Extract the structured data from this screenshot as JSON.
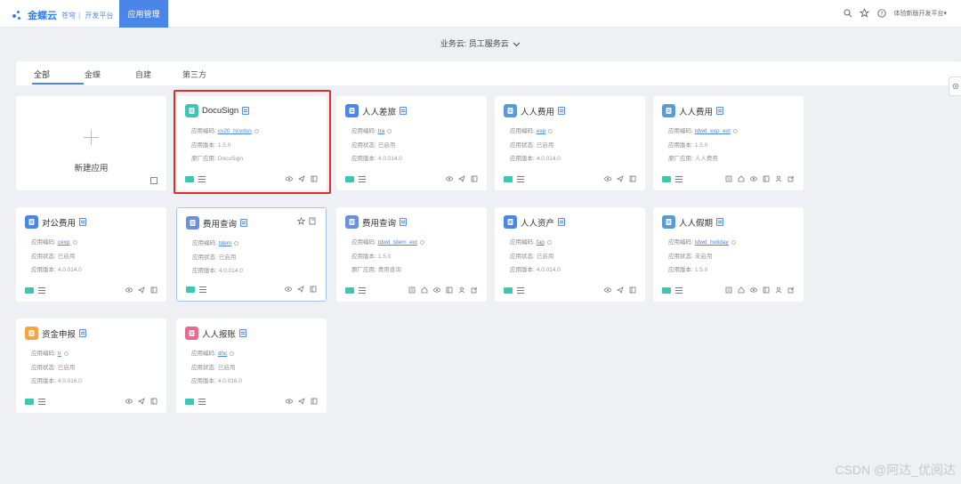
{
  "header": {
    "logo_text": "金蝶云",
    "logo_sub": "苍穹",
    "logo_sep": "|",
    "logo_platform": "开发平台",
    "active_tab": "应用管理",
    "user_menu": "体验新版开发平台"
  },
  "biz_cloud": {
    "label": "业务云:",
    "value": "员工服务云"
  },
  "tabs": [
    "全部",
    "金蝶",
    "自建",
    "第三方"
  ],
  "new_app_label": "新建应用",
  "field_labels": {
    "code": "应用编码:",
    "status": "应用状态:",
    "version": "应用版本:",
    "vendor": "原厂应用:"
  },
  "cards": [
    {
      "name": "DocuSign",
      "icon_color": "#3ec6b0",
      "code": "cv20_hcvdsn",
      "status": null,
      "version": "1.5.0",
      "vendor": "DocuSign"
    },
    {
      "name": "人人差旅",
      "icon_color": "#4a86e8",
      "code": "tra",
      "status": "已启用",
      "version": "4.0.014.0",
      "vendor": null
    },
    {
      "name": "人人费用",
      "icon_color": "#5b9bd5",
      "code": "exp",
      "status": "已启用",
      "version": "4.0.014.0",
      "vendor": null
    },
    {
      "name": "人人费用",
      "icon_color": "#5b9bd5",
      "code": "tdwd_exp_ext",
      "status": null,
      "version": "1.5.0",
      "vendor": "人人费用"
    },
    {
      "name": "对公费用",
      "icon_color": "#4a86e8",
      "code": "cexp",
      "status": "已启用",
      "version": "4.0.014.0",
      "vendor": null
    },
    {
      "name": "费用查询",
      "icon_color": "#6c8fe0",
      "code": "tdem",
      "status": "已启用",
      "version": "4.0.014.0",
      "vendor": null
    },
    {
      "name": "费用查询",
      "icon_color": "#6c8fe0",
      "code": "tdwd_tdem_ext",
      "status": null,
      "version": "1.5.0",
      "vendor": "费用查询"
    },
    {
      "name": "人人资产",
      "icon_color": "#4a86e8",
      "code": "fap",
      "status": "已启用",
      "version": "4.0.014.0",
      "vendor": null
    },
    {
      "name": "人人假期",
      "icon_color": "#5b9bd5",
      "code": "tdwd_holiday",
      "status": "未启用",
      "version": "1.5.0",
      "vendor": null
    },
    {
      "name": "资金申报",
      "icon_color": "#f2a541",
      "code": "tr",
      "status": "已启用",
      "version": "4.0.016.0",
      "vendor": null
    },
    {
      "name": "人人报账",
      "icon_color": "#e86a92",
      "code": "dhc",
      "status": "已启用",
      "version": "4.0.016.0",
      "vendor": null
    }
  ],
  "watermark": "CSDN @阿达_优阅达",
  "colors": {
    "accent": "#4a86e8",
    "highlight": "#e02b2b",
    "tag": "#3ec6b0"
  }
}
